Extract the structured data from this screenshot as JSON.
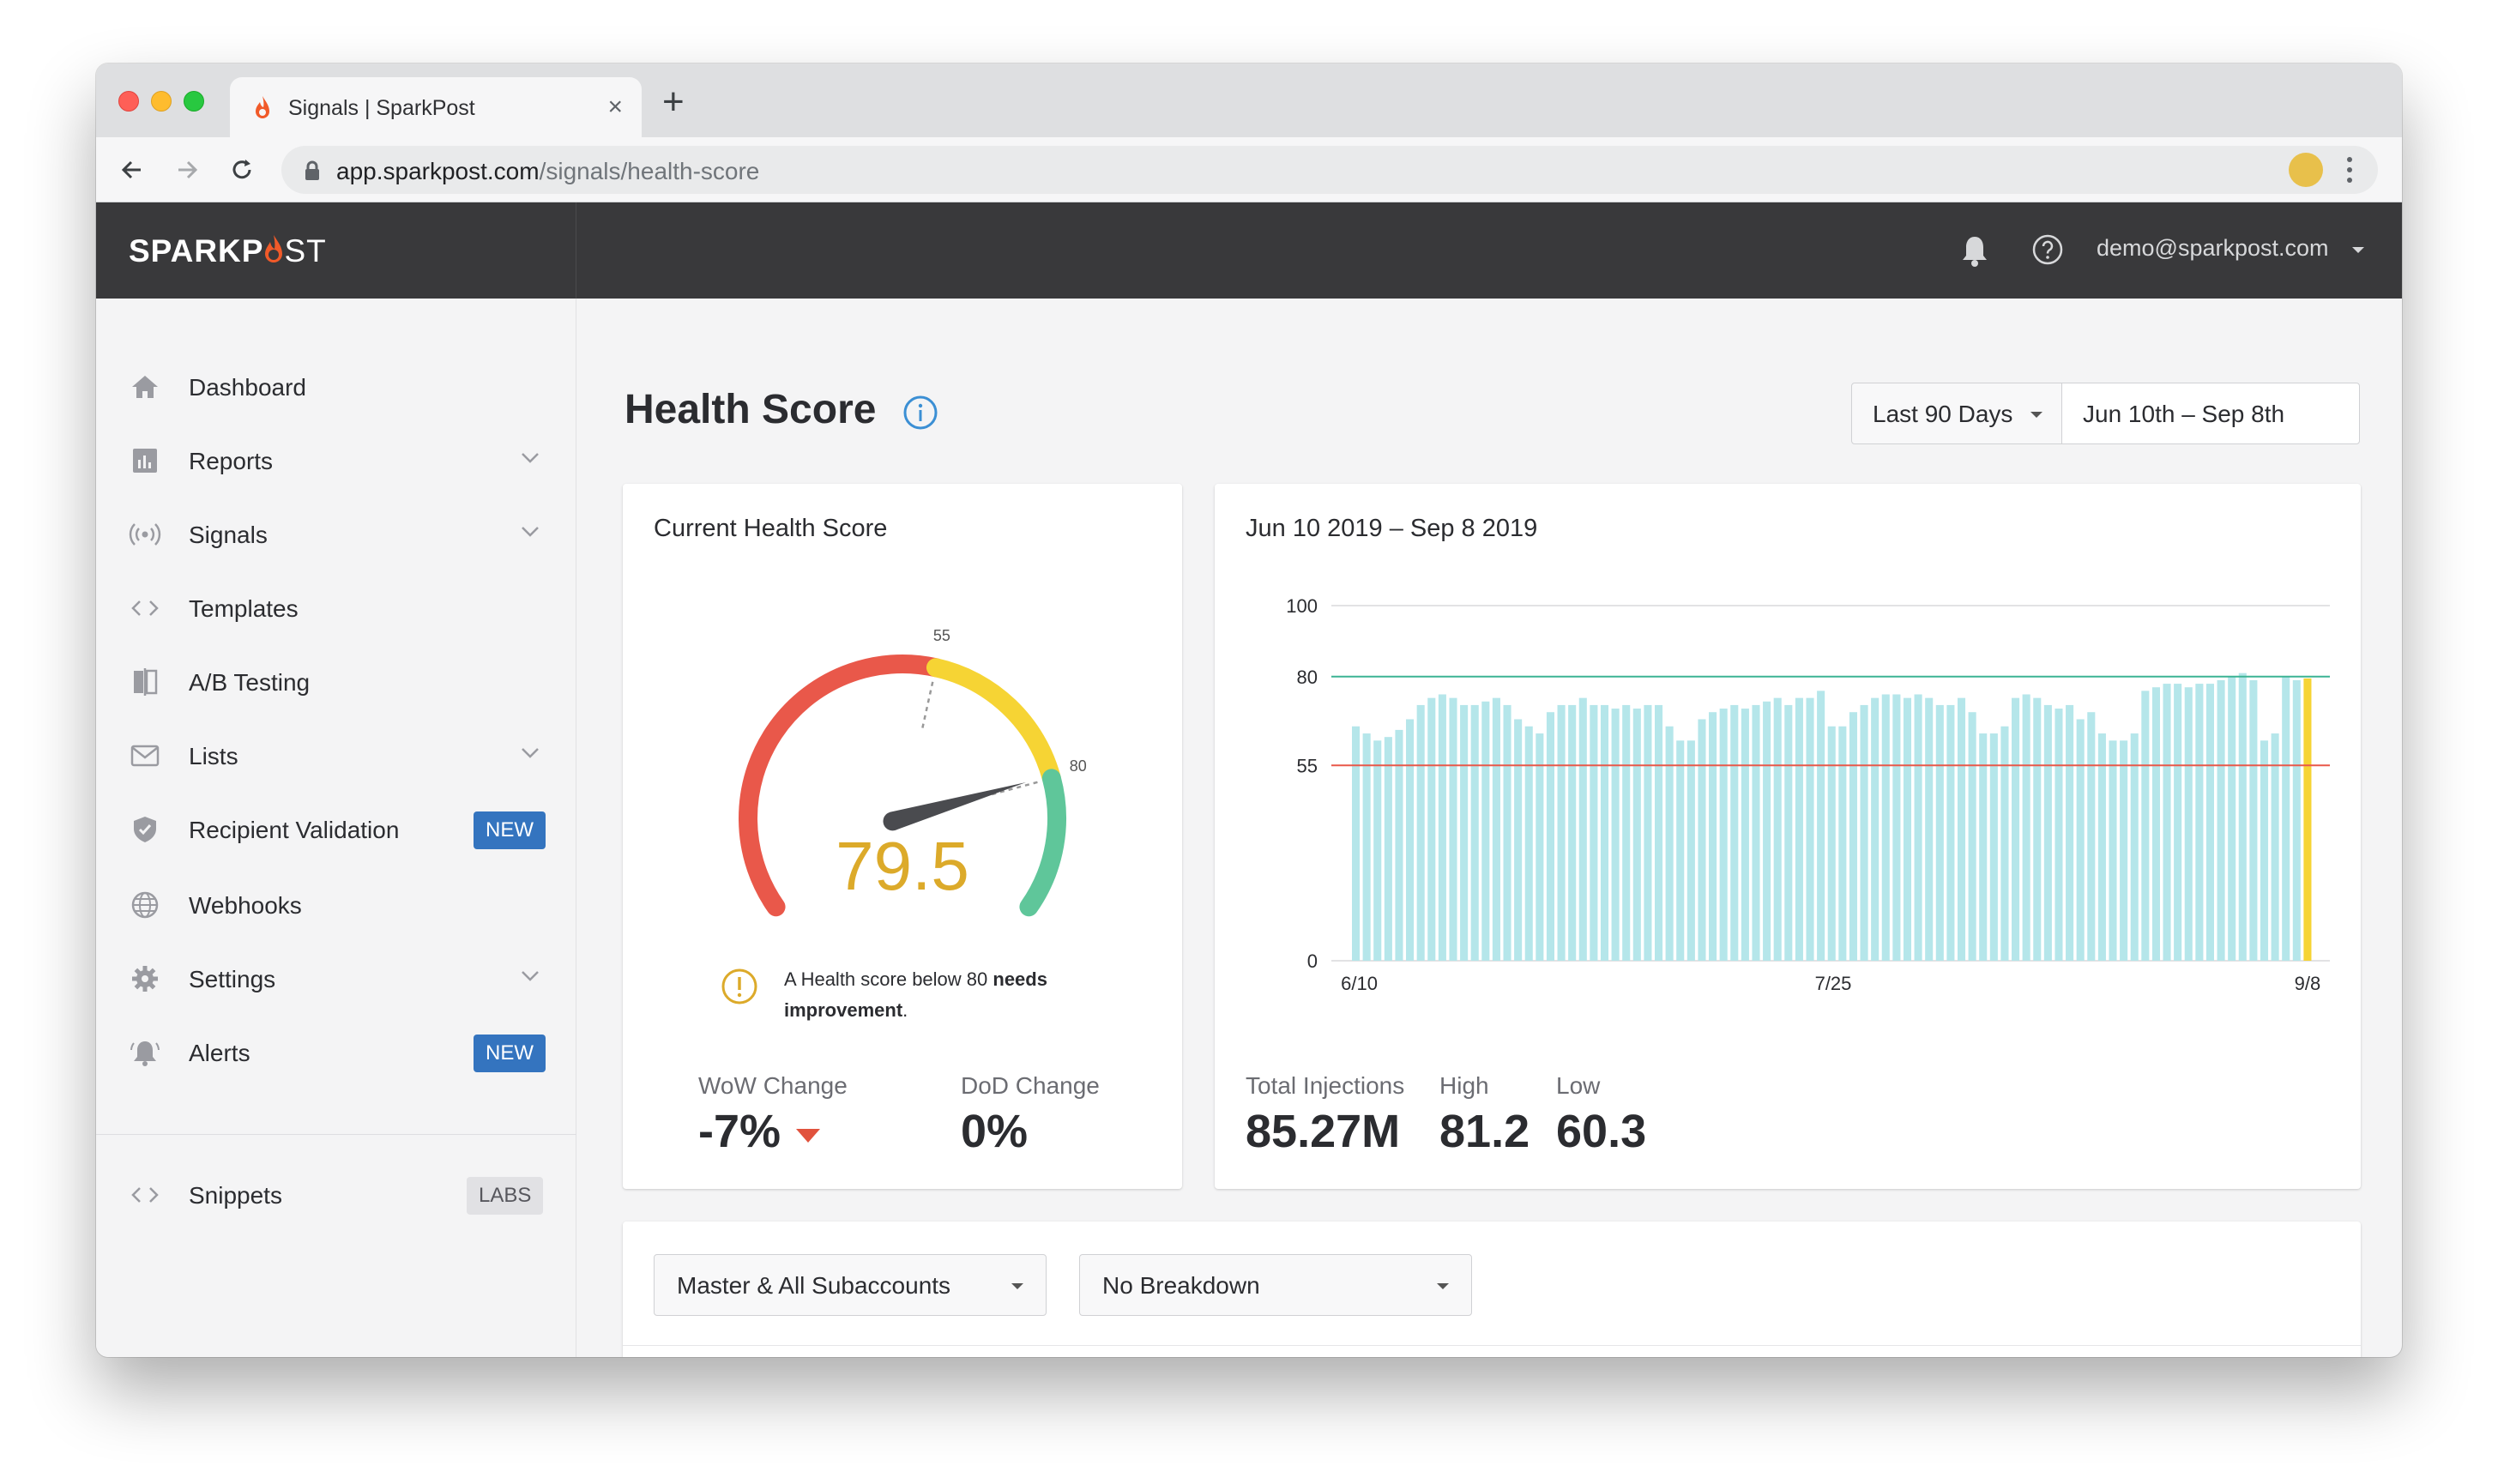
{
  "browser": {
    "tab_title": "Signals | SparkPost",
    "url_host": "app.sparkpost.com",
    "url_path": "/signals/health-score"
  },
  "header": {
    "logo_bold": "SPARKP",
    "logo_thin": "ST",
    "user": "demo@sparkpost.com"
  },
  "sidebar": {
    "items": [
      {
        "label": "Dashboard"
      },
      {
        "label": "Reports"
      },
      {
        "label": "Signals"
      },
      {
        "label": "Templates"
      },
      {
        "label": "A/B Testing"
      },
      {
        "label": "Lists"
      },
      {
        "label": "Recipient Validation",
        "badge": "NEW"
      },
      {
        "label": "Webhooks"
      },
      {
        "label": "Settings"
      },
      {
        "label": "Alerts",
        "badge": "NEW"
      },
      {
        "label": "Snippets",
        "badge": "LABS"
      }
    ]
  },
  "page": {
    "title": "Health Score",
    "range_label": "Last 90 Days",
    "date_range": "Jun 10th – Sep 8th"
  },
  "score_card": {
    "title": "Current Health Score",
    "score": "79.5",
    "gauge_tick_55": "55",
    "gauge_tick_80": "80",
    "warning_prefix": "A Health score below 80 ",
    "warning_bold": "needs improvement",
    "warning_suffix": ".",
    "wow_label": "WoW Change",
    "wow_value": "-7%",
    "dod_label": "DoD Change",
    "dod_value": "0%"
  },
  "chart_card": {
    "title": "Jun 10 2019 – Sep 8 2019",
    "total_label": "Total Injections",
    "total_value": "85.27M",
    "high_label": "High",
    "high_value": "81.2",
    "low_label": "Low",
    "low_value": "60.3"
  },
  "chart_data": {
    "type": "bar",
    "y_ticks": [
      "100",
      "80",
      "55",
      "0"
    ],
    "x_ticks": [
      "6/10",
      "7/25",
      "9/8"
    ],
    "ylim": [
      0,
      100
    ],
    "thresholds": [
      80,
      55
    ],
    "values": [
      66,
      64,
      62,
      63,
      65,
      68,
      72,
      74,
      75,
      74,
      72,
      72,
      73,
      74,
      72,
      68,
      66,
      64,
      70,
      72,
      72,
      74,
      72,
      72,
      71,
      72,
      71,
      72,
      72,
      66,
      62,
      62,
      68,
      70,
      71,
      72,
      71,
      72,
      73,
      74,
      72,
      74,
      74,
      76,
      66,
      66,
      70,
      72,
      74,
      75,
      75,
      74,
      75,
      74,
      72,
      72,
      74,
      70,
      64,
      64,
      66,
      74,
      75,
      74,
      72,
      71,
      72,
      68,
      70,
      64,
      62,
      62,
      64,
      76,
      77,
      78,
      78,
      77,
      78,
      78,
      79,
      80,
      81,
      79,
      62,
      64,
      80,
      79
    ],
    "highlight_last_value": 79.5
  },
  "filters": {
    "account": "Master & All Subaccounts",
    "breakdown": "No Breakdown"
  },
  "colors": {
    "header_bg": "#39393b",
    "teal_bar": "#b5e6ea",
    "highlight_bar": "#f6d434",
    "gauge_red": "#e9584a",
    "gauge_yellow": "#f6d434",
    "gauge_green": "#5fc69a",
    "score_text": "#dcaa2a",
    "badge_blue": "#3474bf"
  }
}
